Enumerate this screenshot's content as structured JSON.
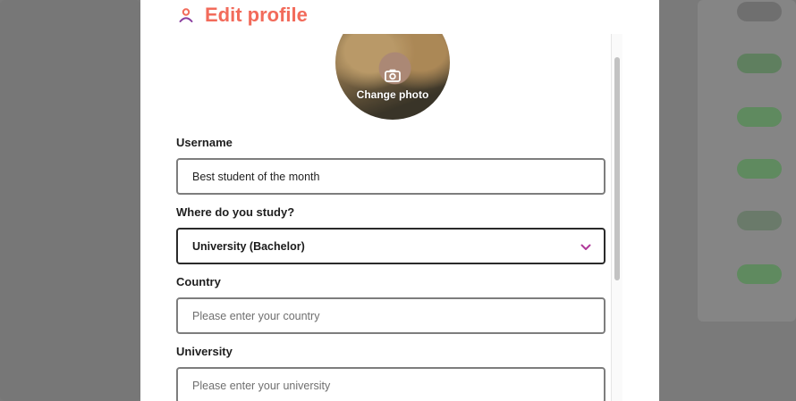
{
  "modal": {
    "title": "Edit profile",
    "title_icon": "person-icon",
    "accent_color": "#f26b5b"
  },
  "avatar": {
    "change_photo_label": "Change photo",
    "icon": "camera-icon"
  },
  "form": {
    "username": {
      "label": "Username",
      "value": "Best student of the month"
    },
    "study": {
      "label": "Where do you study?",
      "selected": "University (Bachelor)",
      "icon": "chevron-down-icon"
    },
    "country": {
      "label": "Country",
      "placeholder": "Please enter your country"
    },
    "university": {
      "label": "University",
      "placeholder": "Please enter your university"
    }
  }
}
